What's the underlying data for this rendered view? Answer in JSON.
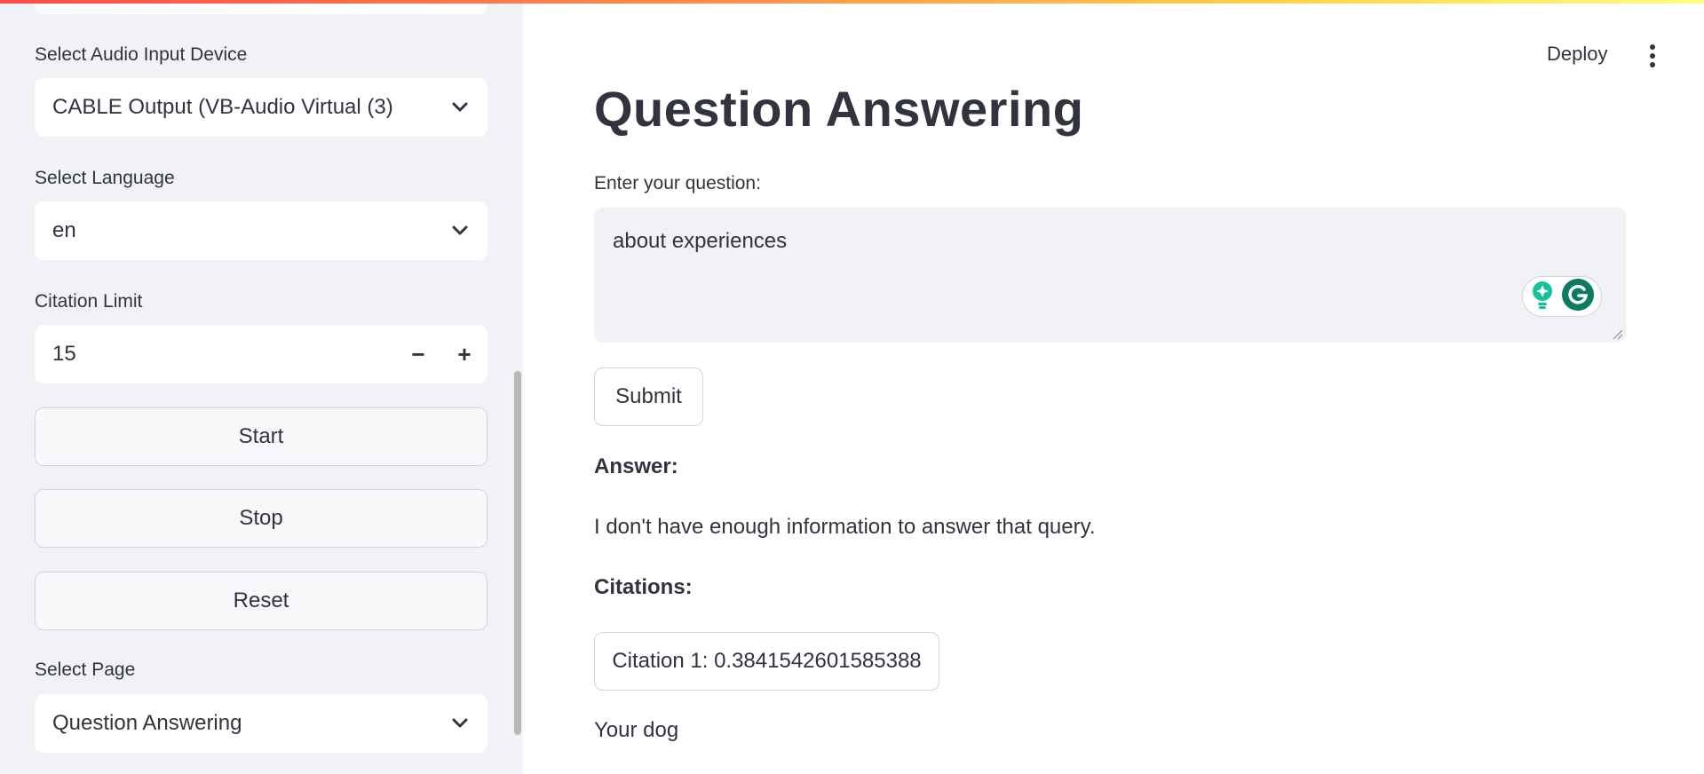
{
  "sidebar": {
    "audio_device": {
      "label": "Select Audio Input Device",
      "value": "CABLE Output (VB-Audio Virtual (3)"
    },
    "language": {
      "label": "Select Language",
      "value": "en"
    },
    "citation_limit": {
      "label": "Citation Limit",
      "value": "15",
      "minus": "−",
      "plus": "+"
    },
    "buttons": {
      "start": "Start",
      "stop": "Stop",
      "reset": "Reset"
    },
    "page": {
      "label": "Select Page",
      "value": "Question Answering"
    }
  },
  "header": {
    "deploy": "Deploy"
  },
  "main": {
    "title": "Question Answering",
    "question_label": "Enter your question:",
    "question_value": "about experiences",
    "submit_label": "Submit",
    "answer_heading": "Answer:",
    "answer_text": "I don't have enough information to answer that query.",
    "citations_heading": "Citations:",
    "citations": [
      {
        "button_label": "Citation 1: 0.3841542601585388",
        "text": "Your dog"
      }
    ]
  },
  "colors": {
    "sidebar_bg": "#f0f2f6",
    "text": "#31333f",
    "grammarly_green": "#15c39a",
    "grammarly_dark": "#0b7b62"
  },
  "icons": [
    "chevron-down-icon",
    "kebab-menu-icon",
    "grammarly-suggestion-icon",
    "grammarly-g-icon"
  ]
}
